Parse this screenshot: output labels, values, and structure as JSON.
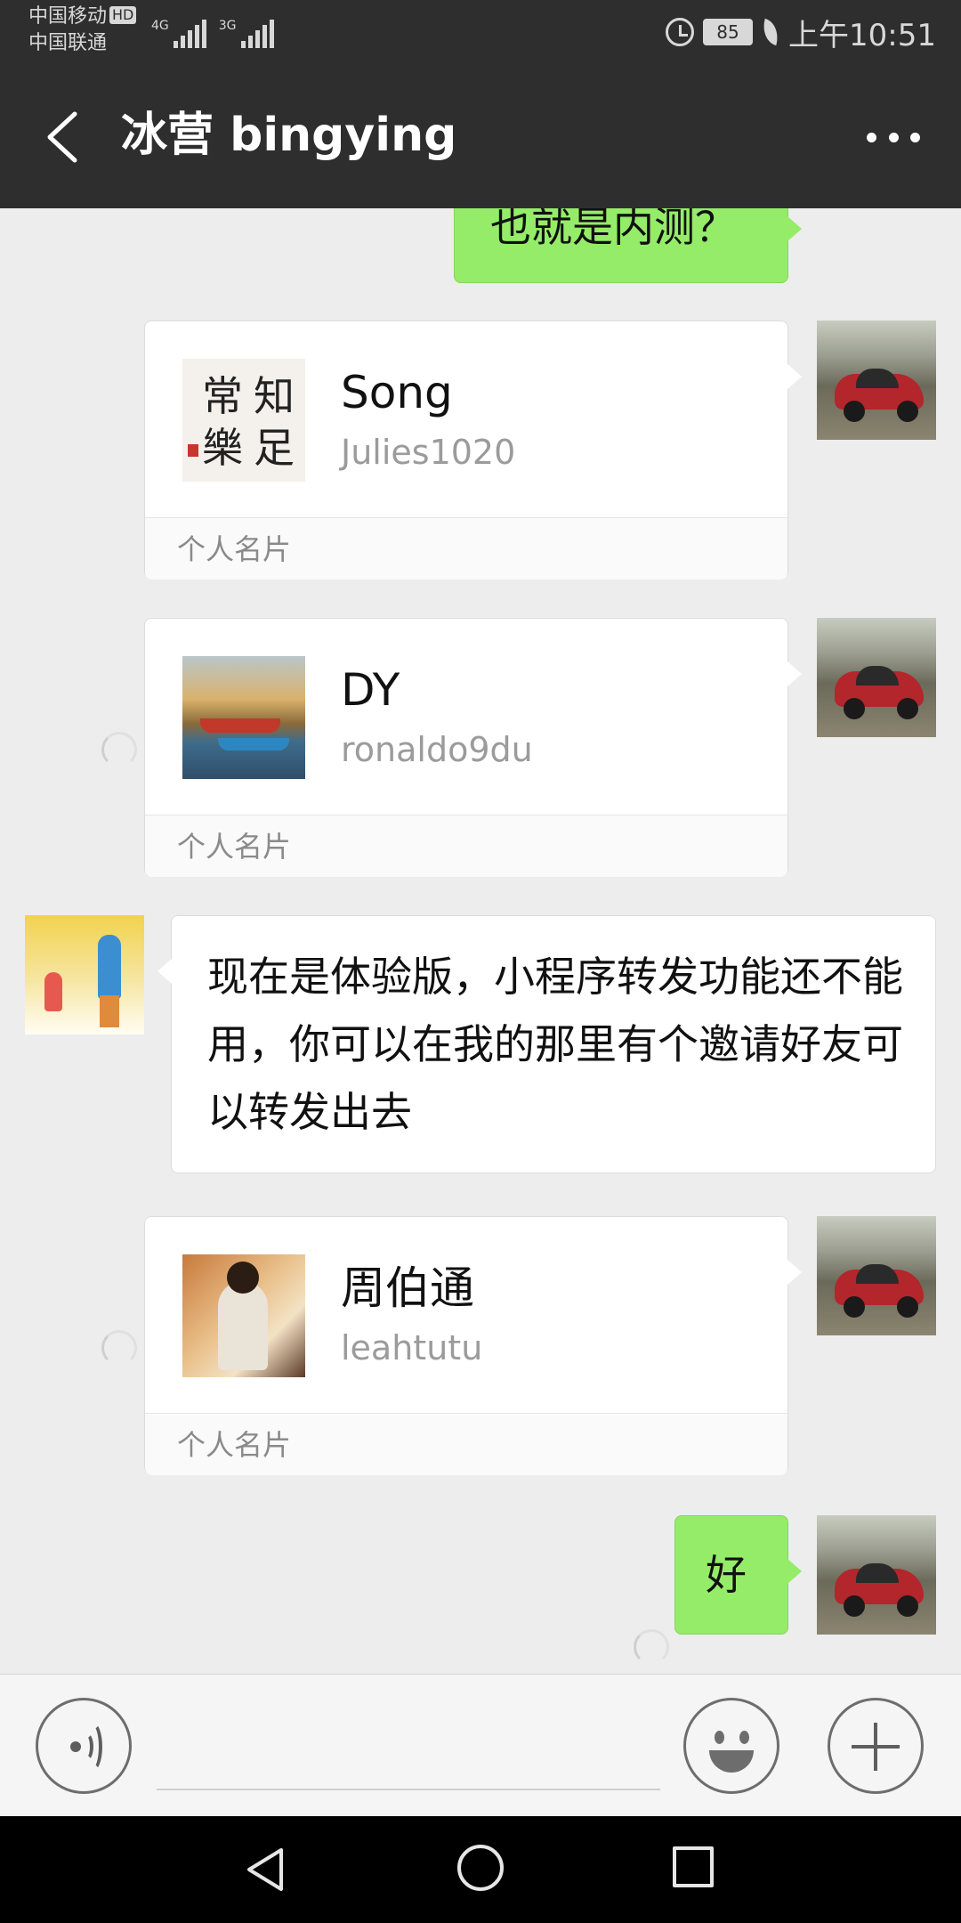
{
  "status_bar": {
    "carrier_1": "中国移动",
    "carrier_1_badge": "HD",
    "carrier_2": "中国联通",
    "network_1": "4G",
    "network_2": "3G",
    "battery": "85",
    "time": "上午10:51"
  },
  "header": {
    "title": "冰营 bingying"
  },
  "messages": {
    "m0": {
      "text": "也就是内测？"
    },
    "m1": {
      "name": "Song",
      "id": "Julies1020",
      "label": "个人名片",
      "thumb_chars": [
        "知",
        "足",
        "常",
        "樂"
      ]
    },
    "m2": {
      "name": "DY",
      "id": "ronaldo9du",
      "label": "个人名片"
    },
    "m3": {
      "text": "现在是体验版，小程序转发功能还不能用，你可以在我的那里有个邀请好友可以转发出去"
    },
    "m4": {
      "name": "周伯通",
      "id": "leahtutu",
      "label": "个人名片"
    },
    "m5": {
      "text": "好"
    }
  },
  "colors": {
    "header_bg": "#2e2e2e",
    "chat_bg": "#ededed",
    "sent_bubble": "#95ec69"
  }
}
